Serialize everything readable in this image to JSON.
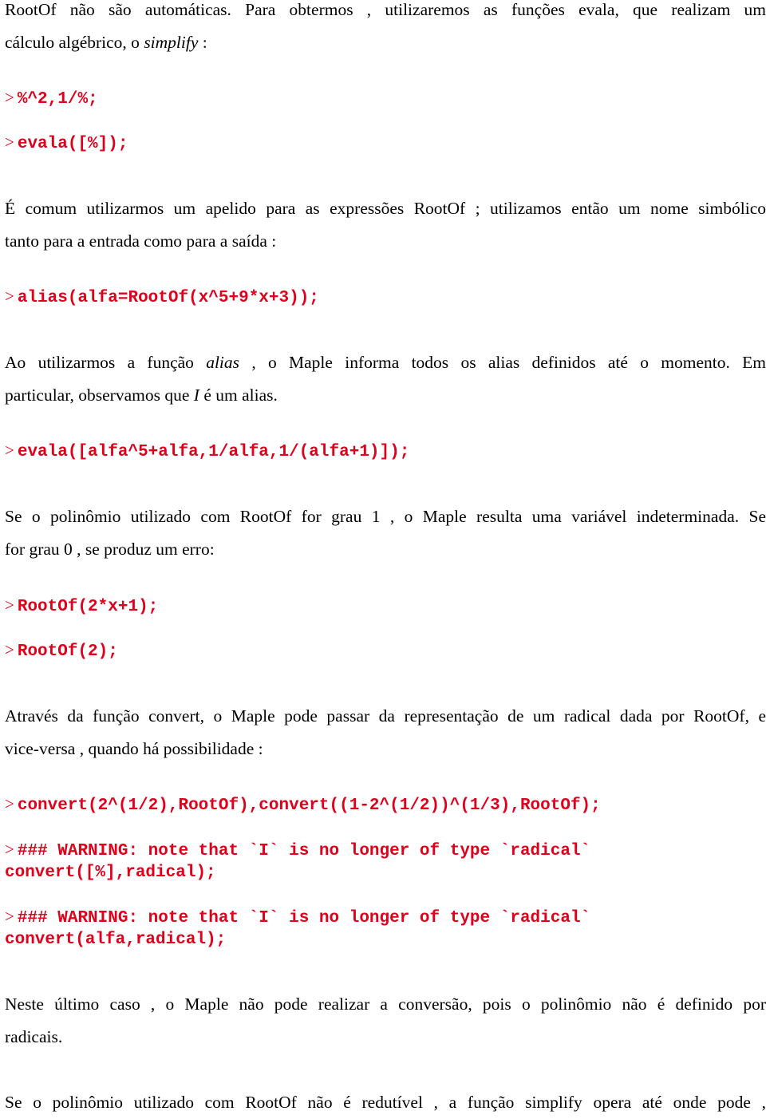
{
  "document": {
    "accent_color": "#e0001b",
    "prompt_symbol": ">",
    "blocks": [
      {
        "type": "text",
        "lines": [
          "RootOf  não são automáticas. Para obtermos , utilizaremos as funções evala, que realizam um"
        ],
        "line2_pre": "cálculo algébrico, o ",
        "line2_em": "simplify",
        "line2_post": " :"
      },
      {
        "type": "command",
        "code": "%^2,1/%;"
      },
      {
        "type": "command",
        "code": "evala([%]);"
      },
      {
        "type": "text",
        "lines": [
          "É comum utilizarmos um apelido para as expressões RootOf ; utilizamos então um nome simbólico",
          "tanto para a entrada como para a saída :"
        ]
      },
      {
        "type": "command",
        "code": "alias(alfa=RootOf(x^5+9*x+3));"
      },
      {
        "type": "text",
        "line1_pre": "Ao utilizarmos a função ",
        "line1_em": "alias",
        "line1_post": " , o Maple informa todos os alias definidos até o momento. Em",
        "line2_pre": "particular, observamos que ",
        "line2_em": "I",
        "line2_post": " é um alias."
      },
      {
        "type": "command",
        "code": "evala([alfa^5+alfa,1/alfa,1/(alfa+1)]);"
      },
      {
        "type": "text",
        "lines": [
          "Se o polinômio utilizado com RootOf  for  grau 1 , o Maple resulta uma variável  indeterminada. Se",
          "for grau 0 , se produz um erro:"
        ]
      },
      {
        "type": "command",
        "code": "RootOf(2*x+1);"
      },
      {
        "type": "command",
        "code": "RootOf(2);"
      },
      {
        "type": "text",
        "lines": [
          "Através da função convert, o Maple  pode passar da representação de um radical dada por RootOf, e",
          "vice-versa , quando há possibilidade :"
        ]
      },
      {
        "type": "command",
        "code": "convert(2^(1/2),RootOf),convert((1-2^(1/2))^(1/3),RootOf);"
      },
      {
        "type": "command",
        "code": "### WARNING: note that `I` is no longer of type `radical`",
        "code2": "convert([%],radical);"
      },
      {
        "type": "command",
        "code": "### WARNING: note that `I` is no longer of type `radical`",
        "code2": "convert(alfa,radical);"
      },
      {
        "type": "text",
        "lines": [
          "Neste  último caso , o Maple não  pode realizar a conversão, pois o polinômio não é definido por",
          "radicais."
        ]
      },
      {
        "type": "text",
        "lines": [
          "Se o polinômio utilizado com RootOf não é redutível , a função simplify opera até onde pode ,"
        ]
      }
    ]
  }
}
